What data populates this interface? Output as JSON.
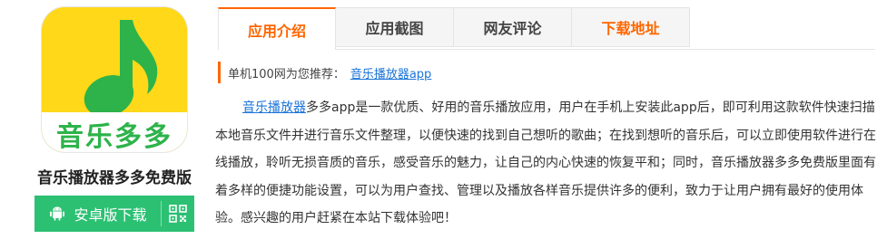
{
  "app": {
    "icon_text": "音乐多多",
    "name": "音乐播放器多多免费版"
  },
  "download": {
    "android_label": "安卓版下载"
  },
  "tabs": [
    {
      "label": "应用介绍"
    },
    {
      "label": "应用截图"
    },
    {
      "label": "网友评论"
    },
    {
      "label": "下载地址"
    }
  ],
  "recommend": {
    "prefix": "单机100网为您推荐：",
    "link": "音乐播放器app"
  },
  "description": {
    "link": "音乐播放器",
    "text": "多多app是一款优质、好用的音乐播放应用，用户在手机上安装此app后，即可利用这款软件快速扫描本地音乐文件并进行音乐文件整理，以便快速的找到自己想听的歌曲；在找到想听的音乐后，可以立即使用软件进行在线播放，聆听无损音质的音乐，感受音乐的魅力，让自己的内心快速的恢复平和；同时，音乐播放器多多免费版里面有着多样的便捷功能设置，可以为用户查找、管理以及播放各样音乐提供许多的便利，致力于让用户拥有最好的使用体验。感兴趣的用户赶紧在本站下载体验吧！"
  },
  "colors": {
    "accent": "#ff6600",
    "download_green": "#2cc073",
    "link_blue": "#1a73d9",
    "icon_yellow": "#ffd81a",
    "icon_green": "#2db34a"
  },
  "icons": [
    "music-note-icon",
    "android-icon",
    "qr-code-icon"
  ]
}
